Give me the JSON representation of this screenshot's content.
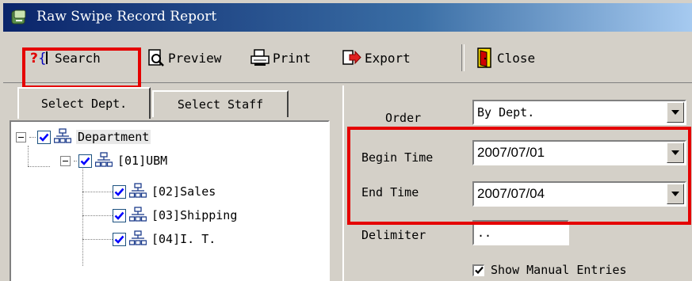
{
  "window": {
    "title": "Raw Swipe Record Report"
  },
  "toolbar": {
    "search_label": "Search",
    "preview_label": "Preview",
    "print_label": "Print",
    "export_label": "Export",
    "close_label": "Close"
  },
  "tabs": [
    {
      "label": "Select Dept.",
      "active": true
    },
    {
      "label": "Select Staff",
      "active": false
    }
  ],
  "tree": {
    "root": {
      "label": "Department",
      "checked": true,
      "expanded": true
    },
    "level1": {
      "label": "[01]UBM",
      "checked": true,
      "expanded": true
    },
    "children": [
      {
        "label": "[02]Sales",
        "checked": true
      },
      {
        "label": "[03]Shipping",
        "checked": true
      },
      {
        "label": "[04]I. T.",
        "checked": true
      }
    ]
  },
  "form": {
    "order_label": "Order",
    "order_value": "By Dept.",
    "begin_label": "Begin Time",
    "begin_value": "2007/07/01",
    "end_label": "End Time",
    "end_value": "2007/07/04",
    "delimiter_label": "Delimiter",
    "delimiter_value": "..",
    "manual_label": "Show Manual Entries",
    "manual_checked": true
  },
  "colors": {
    "highlight": "#e50000",
    "title_bar": "#0a246a",
    "checkbox_tick": "#0000ff"
  }
}
